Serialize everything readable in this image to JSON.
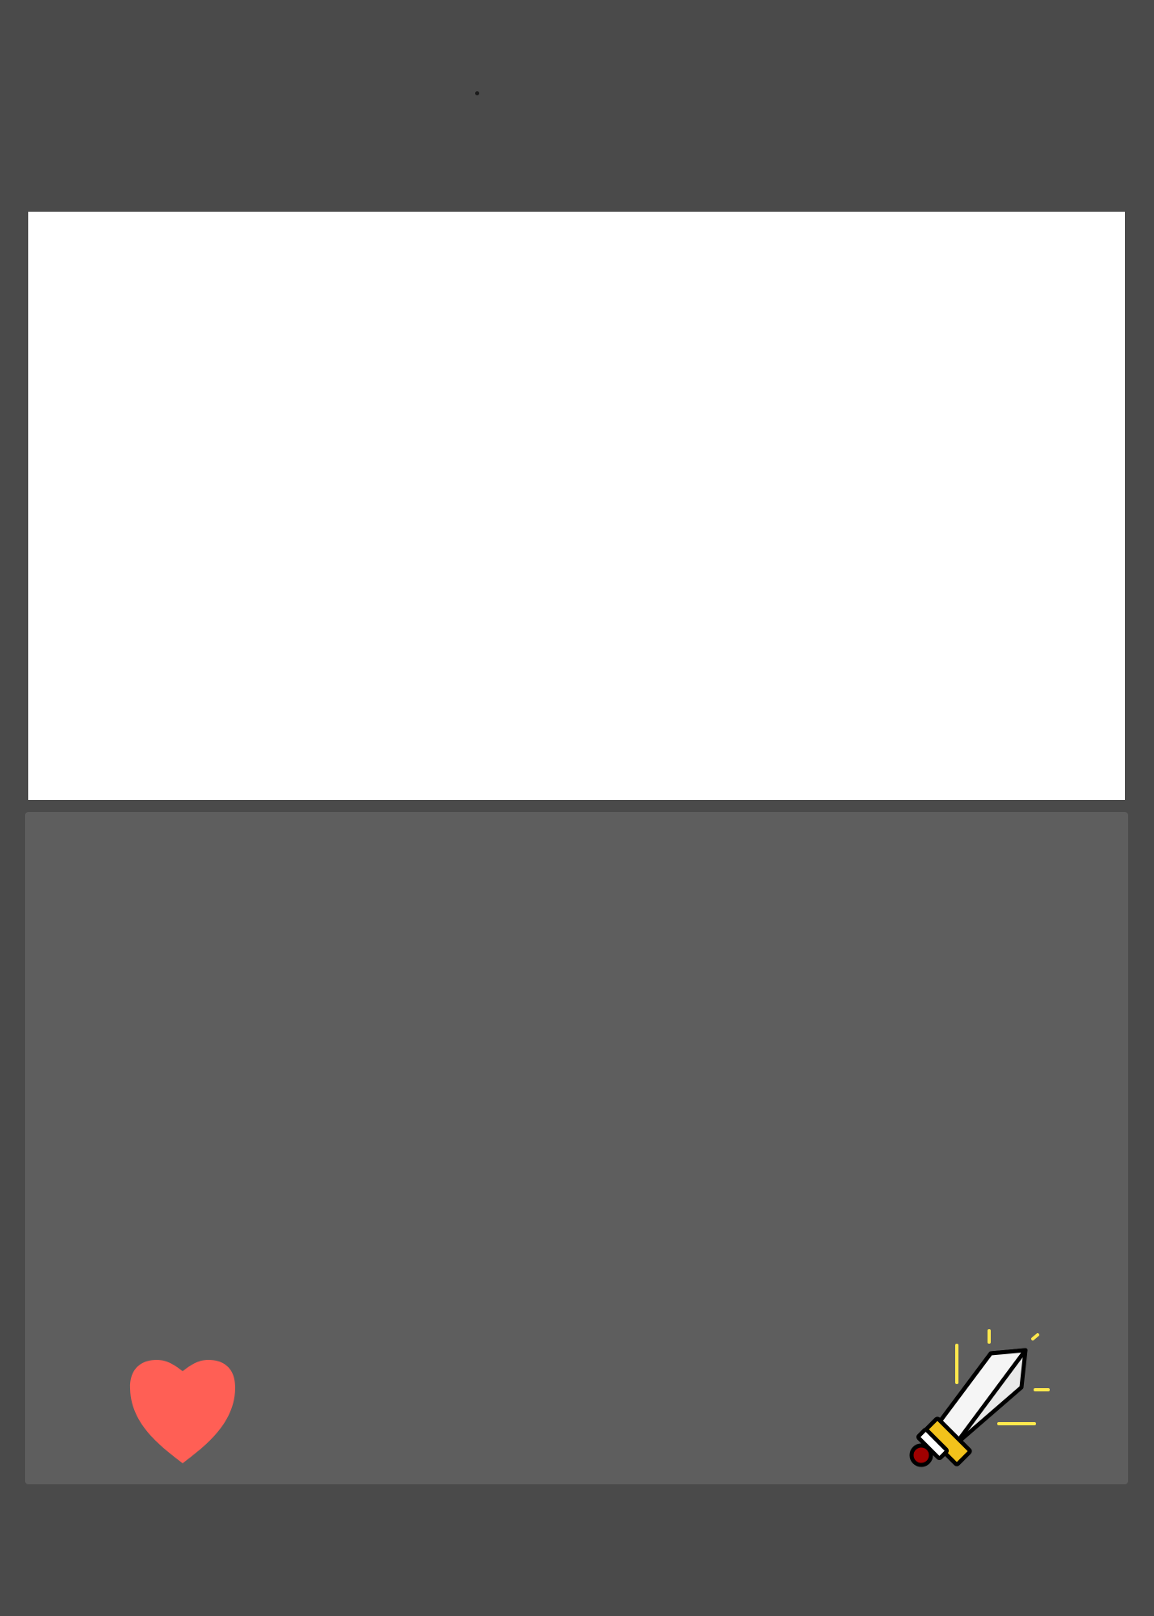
{
  "screen": {
    "name": "battle-screen"
  },
  "colors": {
    "background": "#4a4a4a",
    "canvas": "#ffffff",
    "panel": "#5e5e5e",
    "heart": "#ff5f55",
    "sword_blade": "#e9e9e9",
    "sword_edge": "#000000",
    "sword_guard": "#f2c21b",
    "sword_pommel": "#a00000",
    "sparkle": "#ffe94d"
  },
  "actions": [
    {
      "id": "heal",
      "icon": "heart-icon"
    },
    {
      "id": "attack",
      "icon": "sword-icon"
    }
  ]
}
